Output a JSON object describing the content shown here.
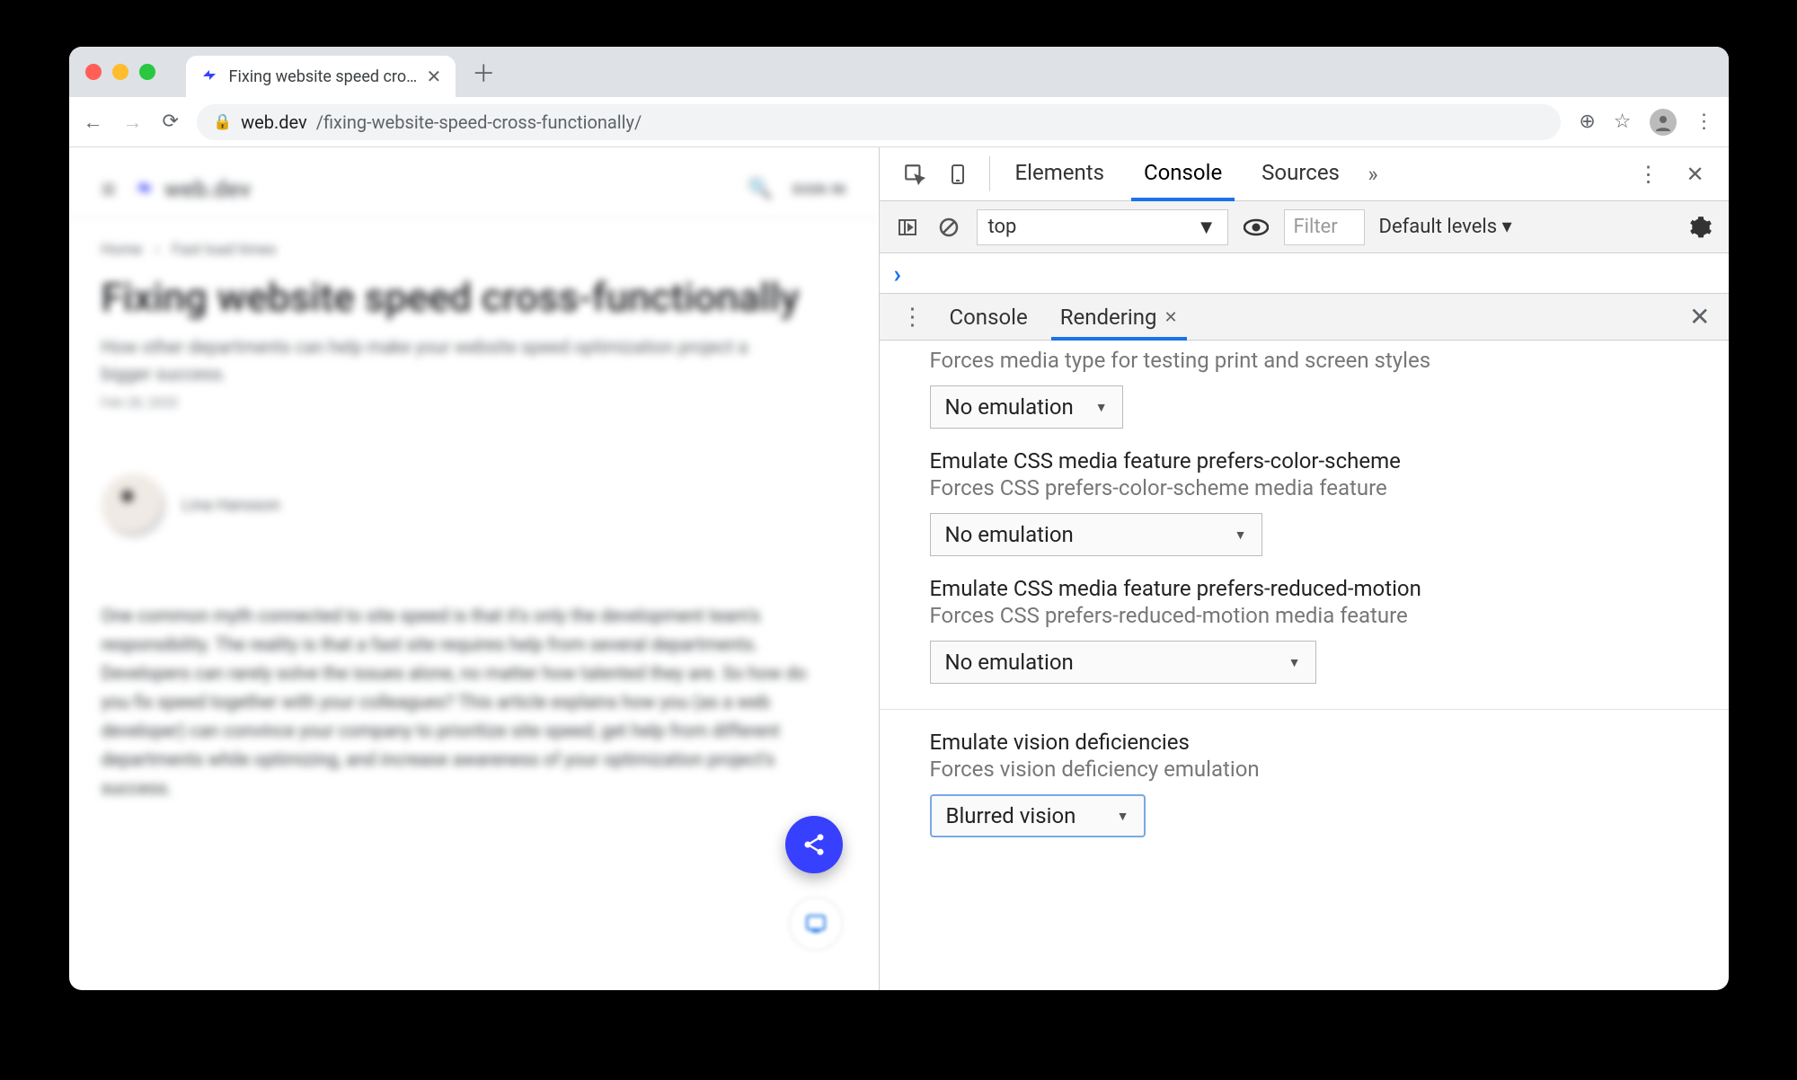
{
  "browser": {
    "tab_title": "Fixing website speed cross-fun",
    "url_host": "web.dev",
    "url_path": "/fixing-website-speed-cross-functionally/"
  },
  "page": {
    "brand": "web.dev",
    "signin": "SIGN IN",
    "crumb_home": "Home",
    "crumb_section": "Fast load times",
    "title": "Fixing website speed cross-functionally",
    "subtitle": "How other departments can help make your website speed optimization project a bigger success.",
    "date": "Feb 28, 2020",
    "author": "Lina Hansson",
    "body": "One common myth connected to site speed is that it's only the development team's responsibility. The reality is that a fast site requires help from several departments. Developers can rarely solve the issues alone, no matter how talented they are. So how do you fix speed together with your colleagues? This article explains how you (as a web developer) can convince your company to prioritize site speed, get help from different departments while optimizing, and increase awareness of your optimization project's success."
  },
  "devtools": {
    "tabs": {
      "elements": "Elements",
      "console": "Console",
      "sources": "Sources"
    },
    "toolbar": {
      "context": "top",
      "filter_placeholder": "Filter",
      "levels": "Default levels ▾"
    },
    "drawer": {
      "console": "Console",
      "rendering": "Rendering"
    },
    "rendering": {
      "media_type": {
        "desc": "Forces media type for testing print and screen styles",
        "value": "No emulation"
      },
      "color_scheme": {
        "title": "Emulate CSS media feature prefers-color-scheme",
        "desc": "Forces CSS prefers-color-scheme media feature",
        "value": "No emulation"
      },
      "reduced_motion": {
        "title": "Emulate CSS media feature prefers-reduced-motion",
        "desc": "Forces CSS prefers-reduced-motion media feature",
        "value": "No emulation"
      },
      "vision": {
        "title": "Emulate vision deficiencies",
        "desc": "Forces vision deficiency emulation",
        "value": "Blurred vision"
      }
    }
  }
}
